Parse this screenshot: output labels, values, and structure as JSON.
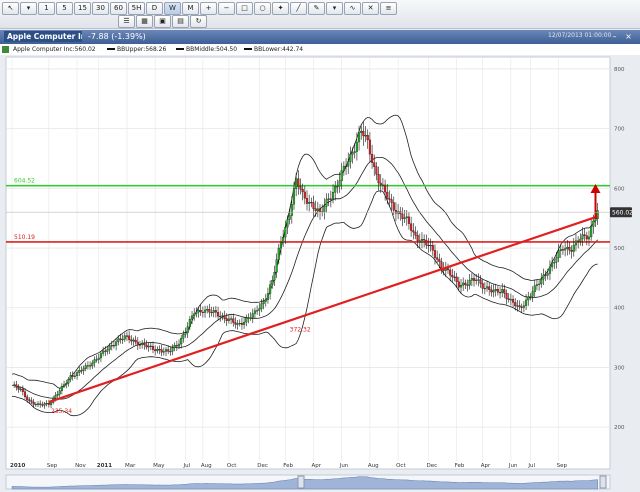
{
  "toolbar": {
    "buttons": [
      {
        "name": "cursor-icon",
        "label": "↖"
      },
      {
        "name": "cursor-menu-icon",
        "label": "▾"
      },
      {
        "name": "period-1-button",
        "label": "1"
      },
      {
        "name": "period-5-button",
        "label": "5"
      },
      {
        "name": "period-15-button",
        "label": "15"
      },
      {
        "name": "period-30-button",
        "label": "30"
      },
      {
        "name": "period-60-button",
        "label": "60"
      },
      {
        "name": "period-5h-button",
        "label": "5H"
      },
      {
        "name": "period-d-button",
        "label": "D"
      },
      {
        "name": "period-w-button",
        "label": "W",
        "selected": true
      },
      {
        "name": "period-m-button",
        "label": "M"
      },
      {
        "name": "zoom-in-icon",
        "label": "+"
      },
      {
        "name": "zoom-out-icon",
        "label": "−"
      },
      {
        "name": "zoom-fit-icon",
        "label": "□"
      },
      {
        "name": "zoom-reset-icon",
        "label": "○"
      },
      {
        "name": "pan-icon",
        "label": "✦"
      },
      {
        "name": "line-tool-icon",
        "label": "╱"
      },
      {
        "name": "pencil-icon",
        "label": "✎"
      },
      {
        "name": "draw-menu-icon",
        "label": "▾"
      },
      {
        "name": "indicator-icon",
        "label": "∿"
      },
      {
        "name": "delete-icon",
        "label": "✕"
      },
      {
        "name": "settings-icon",
        "label": "≡"
      }
    ],
    "row2": [
      {
        "name": "lock-icon",
        "label": "☰"
      },
      {
        "name": "layout-icon",
        "label": "▦"
      },
      {
        "name": "screenshot-icon",
        "label": "▣"
      },
      {
        "name": "print-icon",
        "label": "▤"
      },
      {
        "name": "refresh-icon",
        "label": "↻"
      }
    ]
  },
  "title_bar": {
    "symbol": "Apple Computer Inc (...",
    "change": "-7.88 (-1.39%)",
    "datetime": "12/07/2013 01:00:00"
  },
  "legend": {
    "price": "Apple Computer Inc:560.02",
    "bb_upper": "BBUpper:568.26",
    "bb_middle": "BBMiddle:504.50",
    "bb_lower": "BBLower:442.74"
  },
  "chart_data": {
    "type": "candlestick",
    "y_axis_ticks": [
      200,
      300,
      400,
      500,
      600,
      700,
      800
    ],
    "ylim": [
      150,
      820
    ],
    "x_tick_labels": [
      "2010",
      "Sep",
      "Nov",
      "2011",
      "Mar",
      "May",
      "Jul",
      "Aug",
      "Oct",
      "Dec",
      "Feb",
      "Apr",
      "Jun",
      "Aug",
      "Oct",
      "Dec",
      "Feb",
      "Apr",
      "Jun",
      "Jul",
      "Sep"
    ],
    "x_tick_weeks": [
      0,
      17,
      30,
      40,
      53,
      66,
      80,
      88,
      100,
      114,
      126,
      139,
      152,
      165,
      178,
      192,
      205,
      217,
      230,
      239,
      252
    ],
    "last_price": 560.02,
    "last_price_label": "560.02",
    "horizontal_levels": [
      {
        "label": "604.52",
        "value": 604.52,
        "color": "#33cc33"
      },
      {
        "label": "510.19",
        "value": 510.19,
        "color": "#e02020"
      }
    ],
    "trendline": {
      "color": "#e02020",
      "points": [
        {
          "week": 17,
          "value": 242
        },
        {
          "week": 270,
          "value": 553
        }
      ]
    },
    "trend_labels": [
      {
        "label": "235.34",
        "week": 18,
        "value": 235.34
      },
      {
        "label": "372.32",
        "week": 128,
        "value": 372.32
      }
    ],
    "arrow": {
      "week": 269,
      "from": 550,
      "to": 604,
      "color": "#cc0000"
    },
    "bollinger_colors": {
      "upper": "#222222",
      "middle": "#222222",
      "lower": "#222222"
    },
    "colors": {
      "up": "#22b022",
      "down": "#e02020",
      "background": "#ffffff",
      "grid": "#e6e6e6"
    },
    "close_anchors": [
      [
        0,
        270
      ],
      [
        4,
        262
      ],
      [
        8,
        244
      ],
      [
        12,
        236
      ],
      [
        17,
        240
      ],
      [
        22,
        260
      ],
      [
        27,
        286
      ],
      [
        30,
        290
      ],
      [
        34,
        300
      ],
      [
        38,
        312
      ],
      [
        40,
        318
      ],
      [
        44,
        330
      ],
      [
        48,
        345
      ],
      [
        52,
        350
      ],
      [
        56,
        345
      ],
      [
        60,
        338
      ],
      [
        64,
        332
      ],
      [
        68,
        330
      ],
      [
        72,
        325
      ],
      [
        76,
        338
      ],
      [
        80,
        360
      ],
      [
        84,
        392
      ],
      [
        88,
        397
      ],
      [
        92,
        392
      ],
      [
        96,
        388
      ],
      [
        100,
        380
      ],
      [
        104,
        370
      ],
      [
        108,
        382
      ],
      [
        112,
        390
      ],
      [
        116,
        410
      ],
      [
        120,
        445
      ],
      [
        124,
        510
      ],
      [
        128,
        560
      ],
      [
        131,
        612
      ],
      [
        134,
        588
      ],
      [
        138,
        575
      ],
      [
        142,
        555
      ],
      [
        146,
        585
      ],
      [
        150,
        605
      ],
      [
        154,
        640
      ],
      [
        158,
        670
      ],
      [
        161,
        695
      ],
      [
        164,
        676
      ],
      [
        167,
        635
      ],
      [
        170,
        605
      ],
      [
        174,
        578
      ],
      [
        178,
        560
      ],
      [
        182,
        545
      ],
      [
        186,
        520
      ],
      [
        190,
        510
      ],
      [
        194,
        495
      ],
      [
        198,
        470
      ],
      [
        202,
        455
      ],
      [
        206,
        440
      ],
      [
        210,
        440
      ],
      [
        214,
        448
      ],
      [
        218,
        435
      ],
      [
        222,
        425
      ],
      [
        226,
        430
      ],
      [
        230,
        410
      ],
      [
        234,
        398
      ],
      [
        238,
        418
      ],
      [
        242,
        436
      ],
      [
        246,
        458
      ],
      [
        250,
        478
      ],
      [
        254,
        500
      ],
      [
        258,
        500
      ],
      [
        262,
        515
      ],
      [
        266,
        522
      ],
      [
        268,
        548
      ],
      [
        270,
        560
      ]
    ]
  }
}
